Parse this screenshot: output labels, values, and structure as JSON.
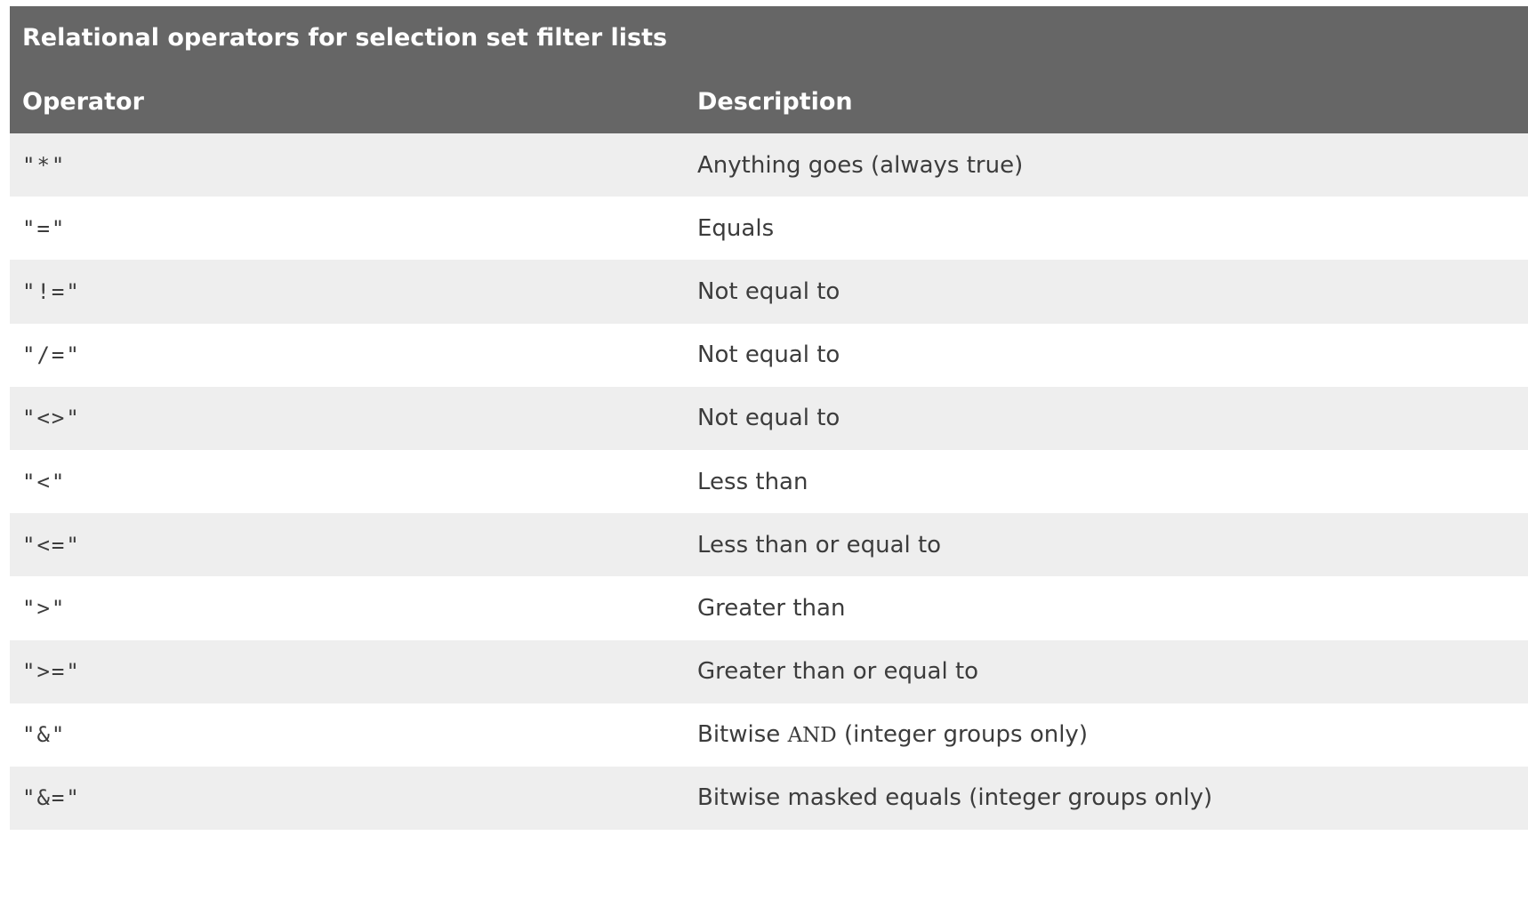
{
  "table": {
    "caption": "Relational operators for selection set filter lists",
    "headers": {
      "operator": "Operator",
      "description": "Description"
    },
    "rows": [
      {
        "operator": "\"*\"",
        "description": "Anything goes (always true)"
      },
      {
        "operator": "\"=\"",
        "description": "Equals"
      },
      {
        "operator": "\"!=\"",
        "description": "Not equal to"
      },
      {
        "operator": "\"/=\"",
        "description": "Not equal to"
      },
      {
        "operator": "\"<>\"",
        "description": "Not equal to"
      },
      {
        "operator": "\"<\"",
        "description": "Less than"
      },
      {
        "operator": "\"<=\"",
        "description": "Less than or equal to"
      },
      {
        "operator": "\">\"",
        "description": "Greater than"
      },
      {
        "operator": "\">=\"",
        "description": "Greater than or equal to"
      },
      {
        "operator": "\"&\"",
        "description_pre": "Bitwise ",
        "description_code": "AND",
        "description_post": " (integer groups only)"
      },
      {
        "operator": "\"&=\"",
        "description": "Bitwise masked equals (integer groups only)"
      }
    ]
  },
  "colors": {
    "header_bg": "#666666",
    "header_text": "#ffffff",
    "row_alt_bg": "#eeeeee",
    "row_bg": "#ffffff",
    "body_text": "#3c3c3c"
  }
}
